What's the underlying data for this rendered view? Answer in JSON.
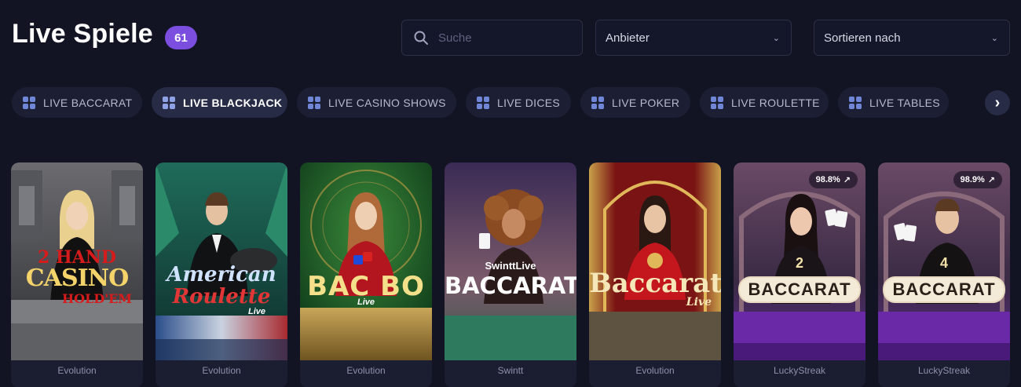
{
  "header": {
    "title": "Live Spiele",
    "count": "61"
  },
  "search": {
    "placeholder": "Suche"
  },
  "filters": {
    "provider_label": "Anbieter",
    "sort_label": "Sortieren nach"
  },
  "categories": [
    {
      "label": "LIVE BACCARAT",
      "active": false
    },
    {
      "label": "LIVE BLACKJACK",
      "active": true
    },
    {
      "label": "LIVE CASINO SHOWS",
      "active": false
    },
    {
      "label": "LIVE DICES",
      "active": false
    },
    {
      "label": "LIVE POKER",
      "active": false
    },
    {
      "label": "LIVE ROULETTE",
      "active": false
    },
    {
      "label": "LIVE TABLES",
      "active": false
    }
  ],
  "games": [
    {
      "logo_line1": "2 HAND",
      "logo_line2": "CASINO",
      "logo_line3": "HOLD'EM",
      "provider": "Evolution"
    },
    {
      "logo_line1": "American",
      "logo_line2": "Roulette",
      "logo_line3": "Live",
      "provider": "Evolution"
    },
    {
      "logo_line1": "BAC BO",
      "logo_line2": "Live",
      "provider": "Evolution"
    },
    {
      "logo_line1": "SwinttLive",
      "logo_line2": "BACCARAT",
      "provider": "Swintt"
    },
    {
      "logo_line1": "Baccarat",
      "logo_line2": "Live",
      "provider": "Evolution"
    },
    {
      "logo_line1": "2",
      "logo_line2": "BACCARAT",
      "rtp": "98.8%",
      "provider": "LuckyStreak"
    },
    {
      "logo_line1": "4",
      "logo_line2": "BACCARAT",
      "rtp": "98.9%",
      "provider": "LuckyStreak"
    }
  ],
  "icons": {
    "search": "search-icon",
    "chevron": "chevron-down-icon",
    "category": "grid-icon",
    "next": "chevron-right-icon",
    "rtp_arrow": "arrow-up-right-icon"
  },
  "colors": {
    "background": "#121423",
    "badge": "#7b4ee0",
    "chip": "#1c1f33",
    "chip_active": "#272b45"
  }
}
